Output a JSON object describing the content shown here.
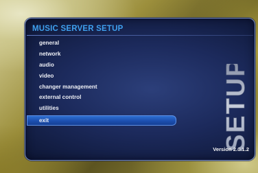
{
  "panel": {
    "title": "MUSIC SERVER SETUP",
    "side_word": "SETUP"
  },
  "menu": {
    "items": [
      {
        "label": "general"
      },
      {
        "label": "network"
      },
      {
        "label": "audio"
      },
      {
        "label": "video"
      },
      {
        "label": "changer management"
      },
      {
        "label": "external control"
      },
      {
        "label": "utilities"
      },
      {
        "label": "exit"
      }
    ],
    "selected_label": "exit"
  },
  "footer": {
    "version": "Version 2.0.1.2"
  },
  "colors": {
    "title": "#3fa0ee",
    "panel": "#1c2a5c",
    "selection": "#2e6fd0",
    "backdrop": "#a69944"
  }
}
